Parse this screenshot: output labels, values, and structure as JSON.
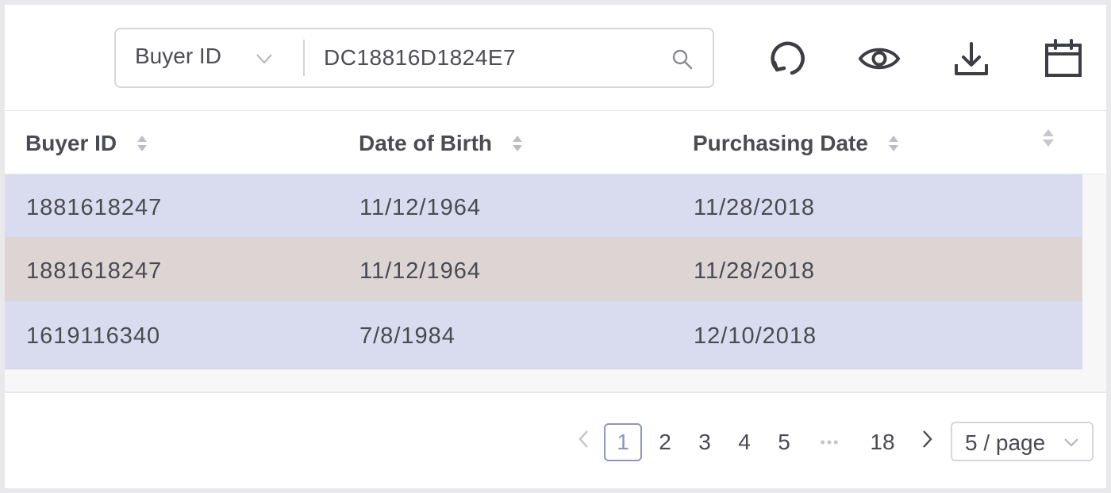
{
  "toolbar": {
    "search_field": {
      "selected": "Buyer ID",
      "chevron_icon": "chevron-down-icon"
    },
    "search_input": {
      "value": "DC18816D1824E7",
      "icon": "search-icon"
    },
    "actions": [
      {
        "name": "refresh-icon"
      },
      {
        "name": "eye-icon"
      },
      {
        "name": "download-icon"
      },
      {
        "name": "calendar-icon"
      }
    ]
  },
  "table": {
    "columns": [
      "Buyer ID",
      "Date of Birth",
      "Purchasing Date"
    ],
    "rows": [
      [
        "1881618247",
        "11/12/1964",
        "11/28/2018"
      ],
      [
        "1881618247",
        "11/12/1964",
        "11/28/2018"
      ],
      [
        "1619116340",
        "7/8/1984",
        "12/10/2018"
      ]
    ],
    "row_colors": [
      "#d8dcee",
      "#dcd5d3",
      "#d8dcee"
    ]
  },
  "pagination": {
    "current": "1",
    "pages": [
      "1",
      "2",
      "3",
      "4",
      "5",
      "18"
    ],
    "page_size": "5 / page",
    "accent": "#8e94c4"
  }
}
